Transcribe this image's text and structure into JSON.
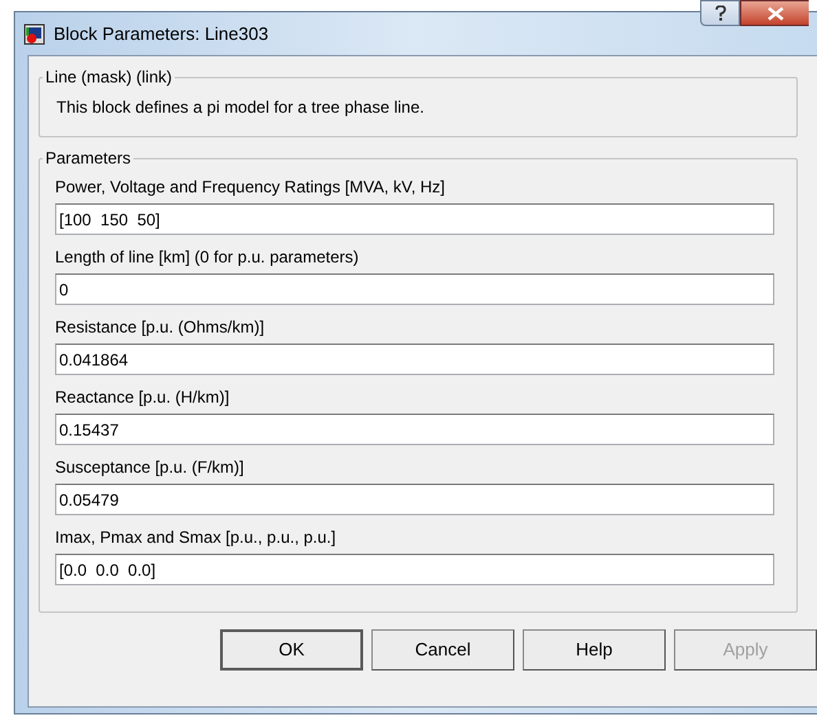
{
  "window": {
    "title": "Block Parameters: Line303"
  },
  "description_group": {
    "title": "Line (mask) (link)",
    "text": "This block defines a pi model for a tree phase line."
  },
  "parameters_group": {
    "title": "Parameters",
    "fields": [
      {
        "label": "Power, Voltage and Frequency Ratings [MVA, kV, Hz]",
        "value": "[100  150  50]"
      },
      {
        "label": "Length of line [km] (0 for p.u. parameters)",
        "value": "0"
      },
      {
        "label": "Resistance [p.u. (Ohms/km)]",
        "value": "0.041864"
      },
      {
        "label": "Reactance [p.u. (H/km)]",
        "value": "0.15437"
      },
      {
        "label": "Susceptance [p.u. (F/km)]",
        "value": "0.05479"
      },
      {
        "label": "Imax, Pmax and Smax [p.u., p.u., p.u.]",
        "value": "[0.0  0.0  0.0]"
      }
    ]
  },
  "buttons": [
    {
      "label": "OK",
      "default": true,
      "disabled": false
    },
    {
      "label": "Cancel",
      "default": false,
      "disabled": false
    },
    {
      "label": "Help",
      "default": false,
      "disabled": false
    },
    {
      "label": "Apply",
      "default": false,
      "disabled": true
    }
  ]
}
